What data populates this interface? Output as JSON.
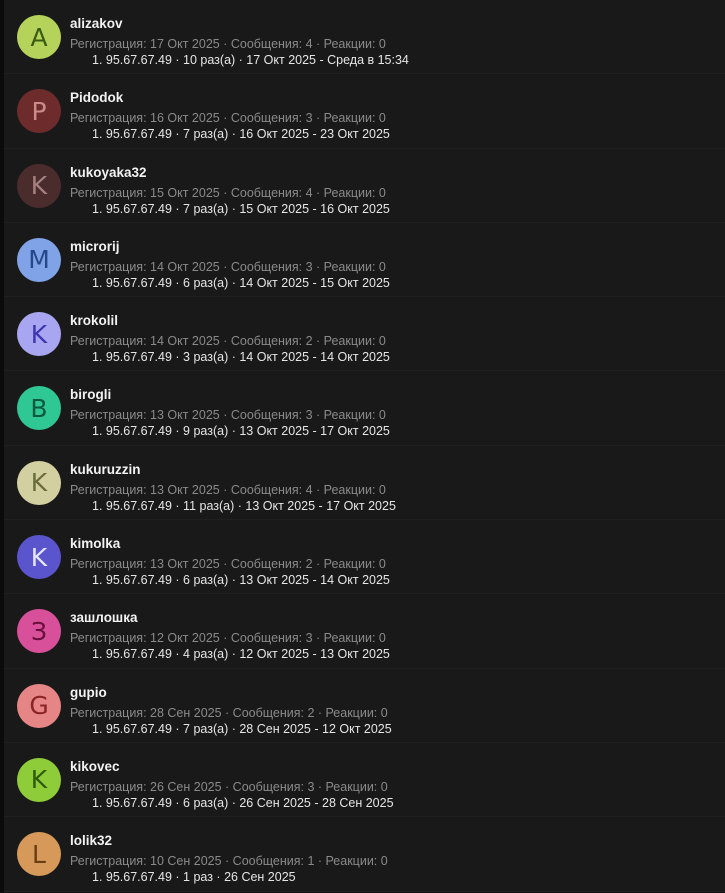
{
  "users": [
    {
      "name": "alizakov",
      "avatar_letter": "A",
      "avatar_bg": "#b5d25a",
      "avatar_fg": "#3a5c10",
      "meta": "Регистрация: 17 Окт 2025 · Сообщения: 4 · Реакции: 0",
      "ip_line": "1. 95.67.67.49 · 10 раз(а) · 17 Окт 2025 - Среда в 15:34"
    },
    {
      "name": "Pidodok",
      "avatar_letter": "P",
      "avatar_bg": "#6e2b2b",
      "avatar_fg": "#c98b8b",
      "meta": "Регистрация: 16 Окт 2025 · Сообщения: 3 · Реакции: 0",
      "ip_line": "1. 95.67.67.49 · 7 раз(а) · 16 Окт 2025 - 23 Окт 2025"
    },
    {
      "name": "kukoyaka32",
      "avatar_letter": "K",
      "avatar_bg": "#4a2c2c",
      "avatar_fg": "#a58080",
      "meta": "Регистрация: 15 Окт 2025 · Сообщения: 4 · Реакции: 0",
      "ip_line": "1. 95.67.67.49 · 7 раз(а) · 15 Окт 2025 - 16 Окт 2025"
    },
    {
      "name": "microrij",
      "avatar_letter": "M",
      "avatar_bg": "#7fa3e6",
      "avatar_fg": "#24488a",
      "meta": "Регистрация: 14 Окт 2025 · Сообщения: 3 · Реакции: 0",
      "ip_line": "1. 95.67.67.49 · 6 раз(а) · 14 Окт 2025 - 15 Окт 2025"
    },
    {
      "name": "krokolil",
      "avatar_letter": "K",
      "avatar_bg": "#a8a6f0",
      "avatar_fg": "#3b35b0",
      "meta": "Регистрация: 14 Окт 2025 · Сообщения: 2 · Реакции: 0",
      "ip_line": "1. 95.67.67.49 · 3 раз(а) · 14 Окт 2025 - 14 Окт 2025"
    },
    {
      "name": "birogli",
      "avatar_letter": "B",
      "avatar_bg": "#2fc793",
      "avatar_fg": "#0b5a40",
      "meta": "Регистрация: 13 Окт 2025 · Сообщения: 3 · Реакции: 0",
      "ip_line": "1. 95.67.67.49 · 9 раз(а) · 13 Окт 2025 - 17 Окт 2025"
    },
    {
      "name": "kukuruzzin",
      "avatar_letter": "K",
      "avatar_bg": "#d2d0a0",
      "avatar_fg": "#6b6a3a",
      "meta": "Регистрация: 13 Окт 2025 · Сообщения: 4 · Реакции: 0",
      "ip_line": "1. 95.67.67.49 · 11 раз(а) · 13 Окт 2025 - 17 Окт 2025"
    },
    {
      "name": "kimolka",
      "avatar_letter": "K",
      "avatar_bg": "#5a55cc",
      "avatar_fg": "#e6e6ff",
      "meta": "Регистрация: 13 Окт 2025 · Сообщения: 2 · Реакции: 0",
      "ip_line": "1. 95.67.67.49 · 6 раз(а) · 13 Окт 2025 - 14 Окт 2025"
    },
    {
      "name": "зашлошка",
      "avatar_letter": "З",
      "avatar_bg": "#d9509a",
      "avatar_fg": "#6a0f3e",
      "meta": "Регистрация: 12 Окт 2025 · Сообщения: 3 · Реакции: 0",
      "ip_line": "1. 95.67.67.49 · 4 раз(а) · 12 Окт 2025 - 13 Окт 2025"
    },
    {
      "name": "gupio",
      "avatar_letter": "G",
      "avatar_bg": "#e68585",
      "avatar_fg": "#8a2424",
      "meta": "Регистрация: 28 Сен 2025 · Сообщения: 2 · Реакции: 0",
      "ip_line": "1. 95.67.67.49 · 7 раз(а) · 28 Сен 2025 - 12 Окт 2025"
    },
    {
      "name": "kikovec",
      "avatar_letter": "K",
      "avatar_bg": "#8ecc3a",
      "avatar_fg": "#2f5a0a",
      "meta": "Регистрация: 26 Сен 2025 · Сообщения: 3 · Реакции: 0",
      "ip_line": "1. 95.67.67.49 · 6 раз(а) · 26 Сен 2025 - 28 Сен 2025"
    },
    {
      "name": "lolik32",
      "avatar_letter": "L",
      "avatar_bg": "#d6995a",
      "avatar_fg": "#6b3d12",
      "meta": "Регистрация: 10 Сен 2025 · Сообщения: 1 · Реакции: 0",
      "ip_line": "1. 95.67.67.49 · 1 раз · 26 Сен 2025"
    }
  ]
}
